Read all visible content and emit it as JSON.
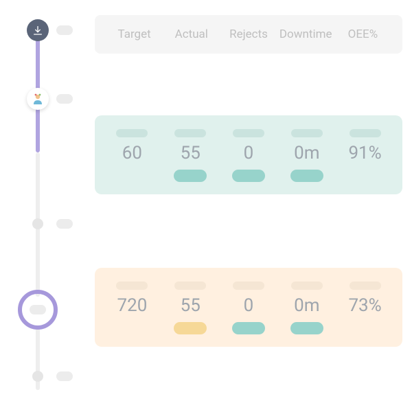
{
  "headers": {
    "target": "Target",
    "actual": "Actual",
    "rejects": "Rejects",
    "downtime": "Downtime",
    "oee": "OEE%"
  },
  "row_green": {
    "target": "60",
    "actual": "55",
    "rejects": "0",
    "downtime": "0m",
    "oee": "91%"
  },
  "row_orange": {
    "target": "720",
    "actual": "55",
    "rejects": "0",
    "downtime": "0m",
    "oee": "73%"
  }
}
